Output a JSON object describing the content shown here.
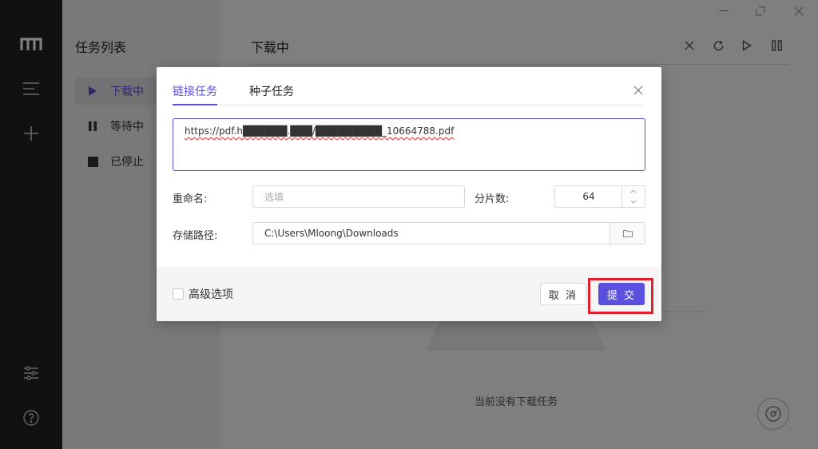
{
  "sidebar": {
    "logo_icon": "logo-m-icon",
    "menu_icon": "menu-icon",
    "add_icon": "plus-icon",
    "settings_icon": "sliders-icon",
    "help_icon": "help-circle-icon"
  },
  "task_panel": {
    "title": "任务列表",
    "items": [
      {
        "label": "下载中",
        "icon": "play-icon"
      },
      {
        "label": "等待中",
        "icon": "pause-icon"
      },
      {
        "label": "已停止",
        "icon": "stop-icon"
      }
    ]
  },
  "main": {
    "title": "下载中",
    "empty_text": "当前没有下载任务"
  },
  "dialog": {
    "tabs": [
      {
        "label": "链接任务"
      },
      {
        "label": "种子任务"
      }
    ],
    "url_value": "https://pdf.h██████.███/█████████_10664788.pdf",
    "rename_label": "重命名:",
    "rename_placeholder": "选填",
    "split_label": "分片数:",
    "split_value": "64",
    "path_label": "存储路径:",
    "path_value": "C:\\Users\\Mloong\\Downloads",
    "advanced_label": "高级选项",
    "cancel_label": "取 消",
    "submit_label": "提 交"
  },
  "colors": {
    "accent": "#5b4fe0",
    "highlight": "#e0202a",
    "sidebar_bg": "#222222"
  }
}
